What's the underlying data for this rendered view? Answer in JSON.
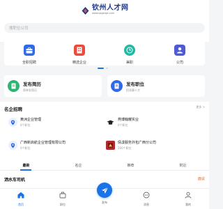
{
  "brand": {
    "name": "钦州人才网",
    "url": "www.qzgerge.com",
    "accent": "#1a73e8"
  },
  "search": {
    "placeholder": "搜职位公司"
  },
  "quick_actions": [
    {
      "label": "全职招聘",
      "icon": "briefcase-icon",
      "color": "#2f6be8"
    },
    {
      "label": "精选企业",
      "icon": "building-icon",
      "color": "#e94b3c"
    },
    {
      "label": "兼职",
      "icon": "clock-icon",
      "color": "#23b8a4"
    },
    {
      "label": "公司",
      "icon": "person-icon",
      "color": "#4f5bd5"
    }
  ],
  "cta": [
    {
      "title": "发布简历",
      "subtitle": "简单发简历",
      "icon": "resume-icon",
      "color": "#2bb673"
    },
    {
      "title": "发布职位",
      "subtitle": "招贤募人才",
      "icon": "post-job-icon",
      "color": "#2f6be8"
    }
  ],
  "famous": {
    "title": "名企招聘",
    "more": "更多 >",
    "companies": [
      {
        "name": "黄洲企业管理",
        "jobs": "0个职位",
        "icon": "location-icon"
      },
      {
        "name": "燕博翰耀实业",
        "jobs": "0个职位",
        "icon": "graduation-cap-icon"
      },
      {
        "name": "广西新启航企业管理有限公司",
        "jobs": "0个职位",
        "icon": "location-icon"
      },
      {
        "name": "倩漾服务外包广西分公司",
        "jobs": "100个职位",
        "icon": "company-logo-icon"
      }
    ]
  },
  "tabs": [
    "最新",
    "名企",
    "推荐",
    "附近"
  ],
  "active_tab": "最新",
  "job": {
    "title": "洒水车司机",
    "salary": "面议"
  },
  "nav": [
    {
      "label": "首页",
      "icon": "home-icon"
    },
    {
      "label": "职位",
      "icon": "job-icon"
    },
    {
      "label": "发布",
      "icon": "send-icon"
    },
    {
      "label": "消息",
      "icon": "message-icon"
    },
    {
      "label": "我的",
      "icon": "user-icon"
    }
  ]
}
